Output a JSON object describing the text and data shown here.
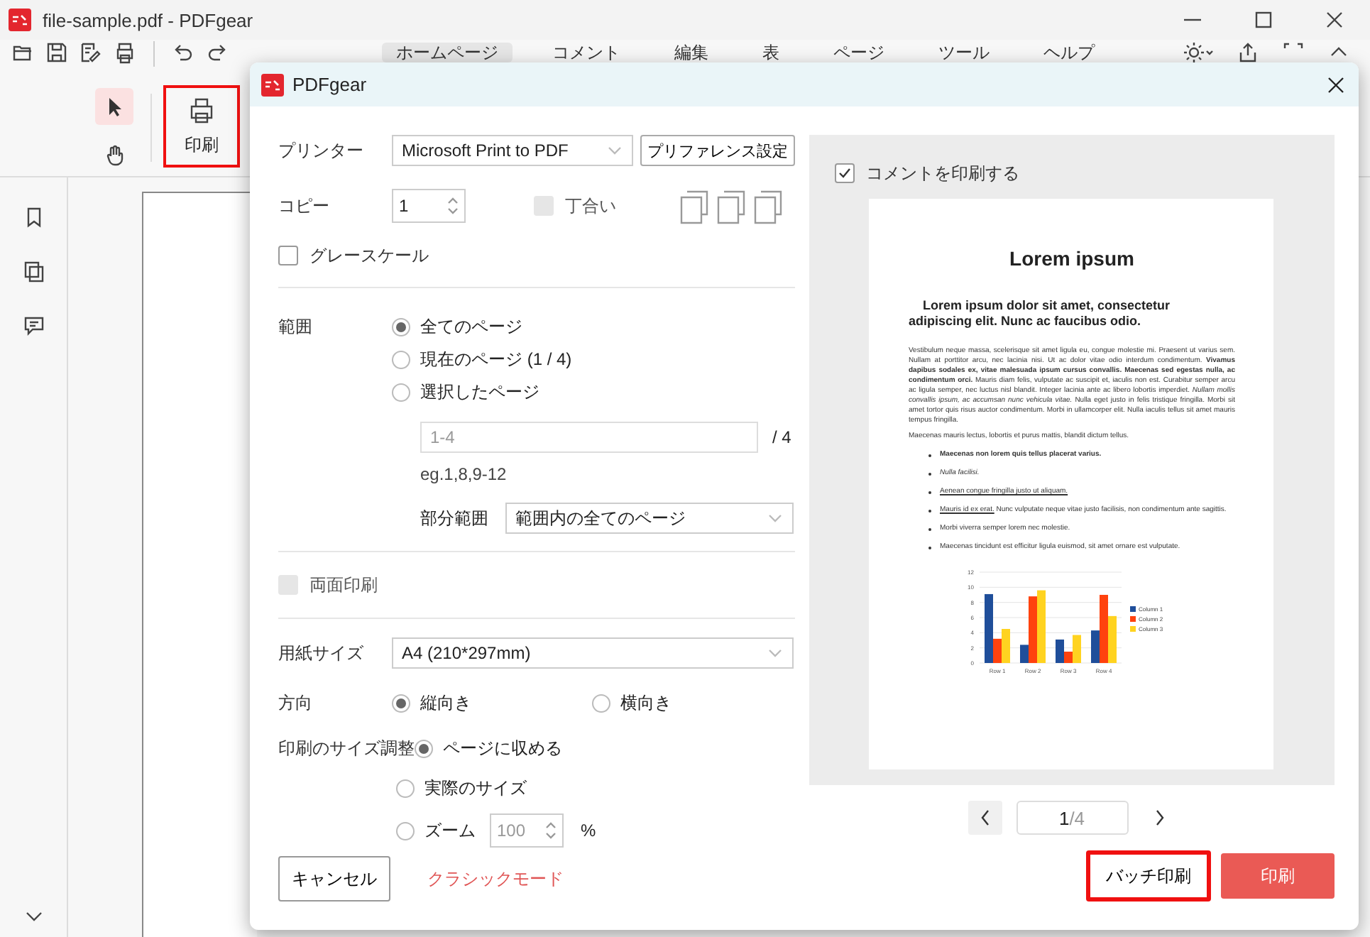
{
  "app": {
    "title": "file-sample.pdf - PDFgear",
    "ribbon_tabs": [
      {
        "label": "ホームページ",
        "selected": true
      },
      {
        "label": "コメント",
        "selected": false
      },
      {
        "label": "編集",
        "selected": false
      },
      {
        "label": "表",
        "selected": false
      },
      {
        "label": "ページ",
        "selected": false
      },
      {
        "label": "ツール",
        "selected": false
      },
      {
        "label": "ヘルプ",
        "selected": false
      }
    ],
    "tools": [
      {
        "kind": "select",
        "selected": true
      },
      {
        "kind": "hand",
        "selected": false
      }
    ],
    "print_button": {
      "label": "印刷",
      "highlighted": true
    }
  },
  "dialog": {
    "title": "PDFgear",
    "printer": {
      "label": "プリンター",
      "value": "Microsoft Print to PDF",
      "button": "プリファレンス設定"
    },
    "copies": {
      "label": "コピー",
      "value": "1",
      "collate": {
        "label": "丁合い",
        "checked": false,
        "disabled": true
      }
    },
    "grayscale": {
      "label": "グレースケール",
      "checked": false,
      "disabled": false
    },
    "range": {
      "label": "範囲",
      "options": [
        {
          "label": "全てのページ",
          "selected": true
        },
        {
          "label": "現在のページ (1 / 4)",
          "selected": false
        },
        {
          "label": "選択したページ",
          "selected": false
        }
      ],
      "pages_field": {
        "placeholder": "1-4",
        "total": "/ 4",
        "hint": "eg.1,8,9-12"
      },
      "subset": {
        "label": "部分範囲",
        "value": "範囲内の全てのページ"
      }
    },
    "duplex": {
      "label": "両面印刷",
      "checked": false,
      "disabled": true
    },
    "paper_size": {
      "label": "用紙サイズ",
      "value": "A4 (210*297mm)"
    },
    "orientation": {
      "label": "方向",
      "options": [
        {
          "label": "縦向き",
          "selected": true
        },
        {
          "label": "横向き",
          "selected": false
        }
      ]
    },
    "scaling": {
      "label": "印刷のサイズ調整",
      "options": [
        {
          "label": "ページに収める",
          "selected": true
        },
        {
          "label": "実際のサイズ",
          "selected": false
        },
        {
          "label": "ズーム",
          "selected": false
        }
      ],
      "zoom": {
        "value": "100",
        "unit": "%",
        "disabled": true
      }
    },
    "print_comments": {
      "label": "コメントを印刷する",
      "checked": true,
      "disabled": false
    },
    "preview": {
      "title": "Lorem ipsum",
      "subtitle": "Lorem ipsum dolor sit amet, consectetur adipiscing elit. Nunc ac faucibus odio.",
      "paragraphs": [
        "Vestibulum neque massa, scelerisque sit amet ligula eu, congue molestie mi. Praesent ut varius sem. Nullam at porttitor arcu, nec lacinia nisi. Ut ac dolor vitae odio interdum condimentum. **Vivamus dapibus sodales ex, vitae malesuada ipsum cursus convallis. Maecenas sed egestas nulla, ac condimentum orci.** Mauris diam felis, vulputate ac suscipit et, iaculis non est. Curabitur semper arcu ac ligula semper, nec luctus nisl blandit. Integer lacinia ante ac libero lobortis imperdiet. *Nullam mollis convallis ipsum, ac accumsan nunc vehicula vitae.* Nulla eget justo in felis tristique fringilla. Morbi sit amet tortor quis risus auctor condimentum. Morbi in ullamcorper elit. Nulla iaculis tellus sit amet mauris tempus fringilla.",
        "Maecenas mauris lectus, lobortis et purus mattis, blandit dictum tellus."
      ],
      "bullets": [
        {
          "text": "**Maecenas non lorem quis tellus placerat varius.**"
        },
        {
          "text": "*Nulla facilisi.*"
        },
        {
          "underlined": "Aenean congue fringilla justo ut aliquam."
        },
        {
          "underlined": "Mauris id ex erat.",
          "text": "Nunc vulputate neque vitae justo facilisis, non condimentum ante sagittis."
        },
        {
          "text": "Morbi viverra semper lorem nec molestie."
        },
        {
          "text": "Maecenas tincidunt est efficitur ligula euismod, sit amet ornare est vulputate."
        }
      ],
      "chart_data": {
        "type": "bar",
        "categories": [
          "Row 1",
          "Row 2",
          "Row 3",
          "Row 4"
        ],
        "series": [
          {
            "name": "Column 1",
            "color": "#1f4e9a",
            "values": [
              9.1,
              2.4,
              3.1,
              4.3
            ]
          },
          {
            "name": "Column 2",
            "color": "#ff420e",
            "values": [
              3.2,
              8.8,
              1.5,
              9
            ]
          },
          {
            "name": "Column 3",
            "color": "#ffd320",
            "values": [
              4.5,
              9.6,
              3.7,
              6.2
            ]
          }
        ],
        "ylim": [
          0,
          12
        ],
        "yticks": [
          0,
          2,
          4,
          6,
          8,
          10,
          12
        ],
        "grid": true,
        "legend": true
      }
    },
    "pagination": {
      "current": "1",
      "total": "/4"
    },
    "buttons": [
      {
        "kind": "cancel",
        "label": "キャンセル"
      },
      {
        "kind": "link",
        "label": "クラシックモード"
      },
      {
        "kind": "batch",
        "label": "バッチ印刷",
        "highlighted": true
      },
      {
        "kind": "primary",
        "label": "印刷"
      }
    ]
  }
}
